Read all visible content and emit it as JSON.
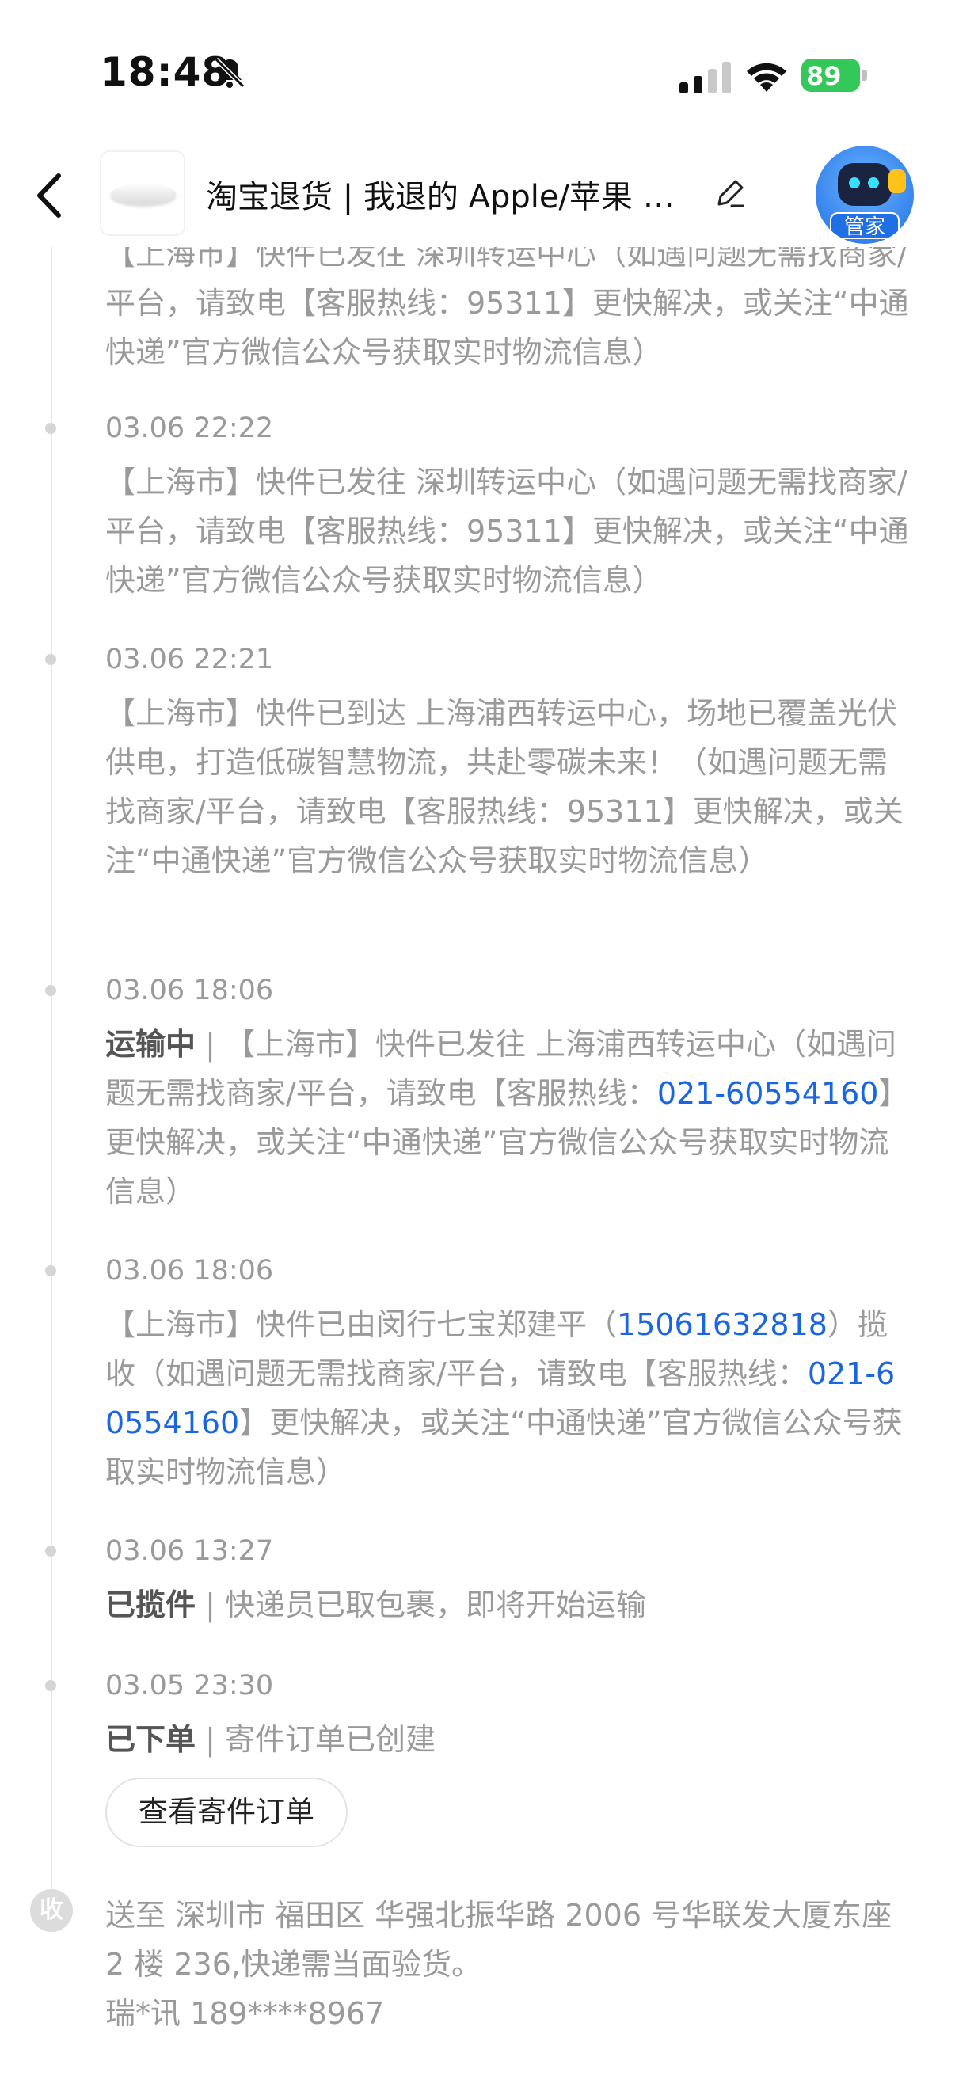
{
  "status_bar": {
    "time": "18:48",
    "battery": "89",
    "icons": [
      "bell-slash-icon",
      "signal-icon",
      "wifi-icon",
      "battery-icon"
    ]
  },
  "header": {
    "title": "淘宝退货 | 我退的 Apple/苹果 Magic Mouse",
    "avatar_tag": "管家",
    "icons": [
      "back-icon",
      "edit-icon"
    ]
  },
  "timeline": {
    "partial_top": "【上海市】快件已发往 深圳转运中心（如遇问题无需找商家/平台，请致电【客服热线：95311】更快解决，或关注“中通快递”官方微信公众号获取实时物流信息）",
    "entries": [
      {
        "date": "03.06 22:22",
        "text": "【上海市】快件已发往 深圳转运中心（如遇问题无需找商家/平台，请致电【客服热线：95311】更快解决，或关注“中通快递”官方微信公众号获取实时物流信息）"
      },
      {
        "date": "03.06 22:21",
        "text": "【上海市】快件已到达 上海浦西转运中心，场地已覆盖光伏供电，打造低碳智慧物流，共赴零碳未来！（如遇问题无需找商家/平台，请致电【客服热线：95311】更快解决，或关注“中通快递”官方微信公众号获取实时物流信息）"
      },
      {
        "date": "03.06 18:06",
        "status": "运输中",
        "text_a": " | 【上海市】快件已发往 上海浦西转运中心（如遇问题无需找商家/平台，请致电【客服热线：",
        "phone": "021-60554160",
        "text_b": "】更快解决，或关注“中通快递”官方微信公众号获取实时物流信息）"
      },
      {
        "date": "03.06 18:06",
        "text_a": "【上海市】快件已由闵行七宝郑建平（",
        "courier_phone": "15061632818",
        "text_b": "）揽收（如遇问题无需找商家/平台，请致电【客服热线：",
        "phone": "021-60554160",
        "text_c": "】更快解决，或关注“中通快递”官方微信公众号获取实时物流信息）"
      },
      {
        "date": "03.06 13:27",
        "status": "已揽件",
        "text": " | 快递员已取包裹，即将开始运输"
      },
      {
        "date": "03.05 23:30",
        "status": "已下单",
        "text": " | 寄件订单已创建"
      }
    ],
    "order_button": "查看寄件订单"
  },
  "receiver": {
    "icon_label": "收",
    "address": "送至 深圳市 福田区 华强北振华路 2006 号华联发大厦东座 2 楼 236,快递需当面验货。",
    "contact": "瑞*讯 189****8967"
  }
}
